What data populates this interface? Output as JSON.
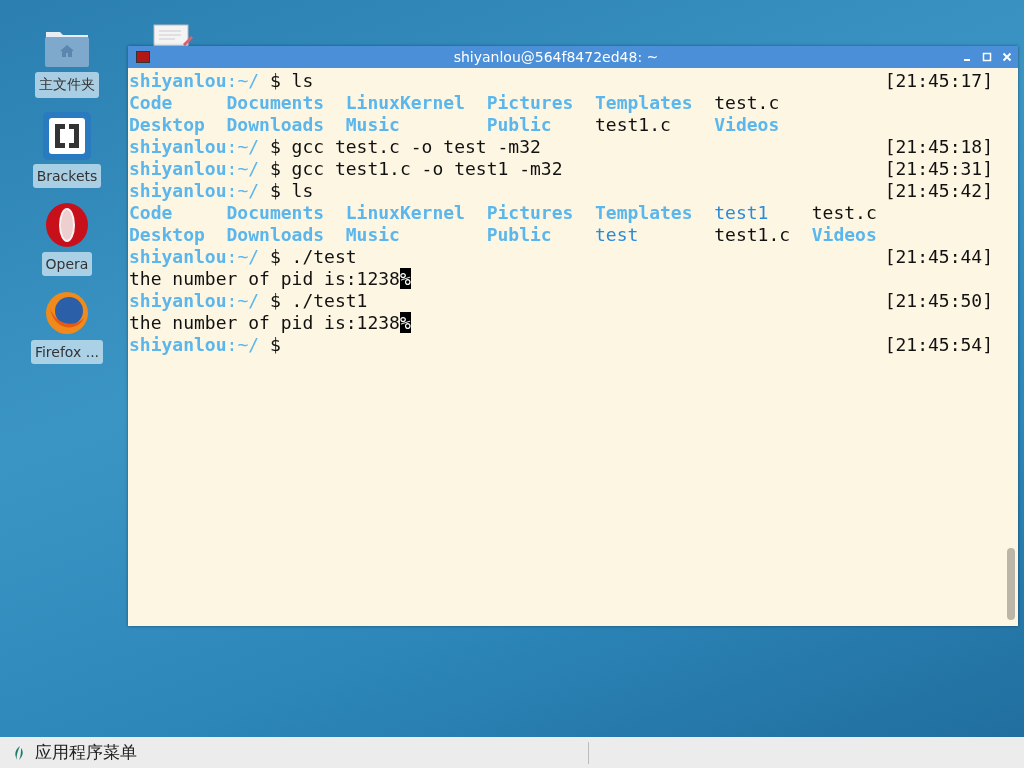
{
  "desktop_icons": [
    {
      "label": "主文件夹",
      "kind": "folder"
    },
    {
      "label": "Brackets",
      "kind": "brackets"
    },
    {
      "label": "Opera",
      "kind": "opera"
    },
    {
      "label": "Firefox ...",
      "kind": "firefox"
    }
  ],
  "window": {
    "title": "shiyanlou@564f8472ed48: ~"
  },
  "terminal": {
    "lines": [
      {
        "kind": "prompt",
        "user": "shiyanlou",
        "path": ":~/",
        "command": "$ ls",
        "time": "[21:45:17]"
      },
      {
        "kind": "listing",
        "rows": [
          [
            {
              "name": "Code",
              "kind": "dir"
            },
            {
              "name": "Documents",
              "kind": "dir"
            },
            {
              "name": "LinuxKernel",
              "kind": "dir"
            },
            {
              "name": "Pictures",
              "kind": "dir"
            },
            {
              "name": "Templates",
              "kind": "dir"
            },
            {
              "name": "test.c",
              "kind": "file"
            }
          ],
          [
            {
              "name": "Desktop",
              "kind": "dir"
            },
            {
              "name": "Downloads",
              "kind": "dir"
            },
            {
              "name": "Music",
              "kind": "dir"
            },
            {
              "name": "Public",
              "kind": "dir"
            },
            {
              "name": "test1.c",
              "kind": "file"
            },
            {
              "name": "Videos",
              "kind": "dir"
            }
          ]
        ]
      },
      {
        "kind": "prompt",
        "user": "shiyanlou",
        "path": ":~/",
        "command": "$ gcc test.c -o test -m32",
        "time": "[21:45:18]"
      },
      {
        "kind": "prompt",
        "user": "shiyanlou",
        "path": ":~/",
        "command": "$ gcc test1.c -o test1 -m32",
        "time": "[21:45:31]"
      },
      {
        "kind": "prompt",
        "user": "shiyanlou",
        "path": ":~/",
        "command": "$ ls",
        "time": "[21:45:42]"
      },
      {
        "kind": "listing",
        "rows": [
          [
            {
              "name": "Code",
              "kind": "dir"
            },
            {
              "name": "Documents",
              "kind": "dir"
            },
            {
              "name": "LinuxKernel",
              "kind": "dir"
            },
            {
              "name": "Pictures",
              "kind": "dir"
            },
            {
              "name": "Templates",
              "kind": "dir"
            },
            {
              "name": "test1",
              "kind": "exec"
            },
            {
              "name": "test.c",
              "kind": "file"
            }
          ],
          [
            {
              "name": "Desktop",
              "kind": "dir"
            },
            {
              "name": "Downloads",
              "kind": "dir"
            },
            {
              "name": "Music",
              "kind": "dir"
            },
            {
              "name": "Public",
              "kind": "dir"
            },
            {
              "name": "test",
              "kind": "exec"
            },
            {
              "name": "test1.c",
              "kind": "file"
            },
            {
              "name": "Videos",
              "kind": "dir"
            }
          ]
        ]
      },
      {
        "kind": "prompt",
        "user": "shiyanlou",
        "path": ":~/",
        "command": "$ ./test",
        "time": "[21:45:44]"
      },
      {
        "kind": "output",
        "text": "the number of pid is:1238",
        "end_mark": "%"
      },
      {
        "kind": "prompt",
        "user": "shiyanlou",
        "path": ":~/",
        "command": "$ ./test1",
        "time": "[21:45:50]"
      },
      {
        "kind": "output",
        "text": "the number of pid is:1238",
        "end_mark": "%"
      },
      {
        "kind": "prompt",
        "user": "shiyanlou",
        "path": ":~/",
        "command": "$",
        "time": "[21:45:54]"
      }
    ]
  },
  "taskbar": {
    "menu_label": "应用程序菜单"
  }
}
